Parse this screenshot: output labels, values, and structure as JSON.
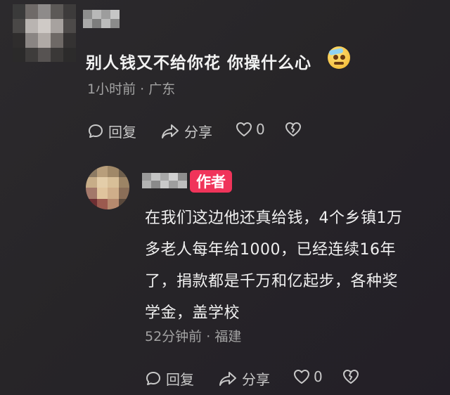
{
  "comment": {
    "text": "别人钱又不给你花 你操什么心",
    "emoji_icon": "sweating-face-icon",
    "time": "1小时前",
    "location": "广东",
    "reply_label": "回复",
    "share_label": "分享",
    "like_count": "0"
  },
  "reply": {
    "badge": "作者",
    "badge_color": "#f0345a",
    "lines": [
      "在我们这边他还真给钱，4个乡镇1万",
      "多老人每年给1000，已经连续16年",
      "了，捐款都是千万和亿起步，各种奖",
      "学金，盖学校"
    ],
    "time": "52分钟前",
    "location": "福建",
    "reply_label": "回复",
    "share_label": "分享",
    "like_count": "0"
  },
  "meta_separator": "·"
}
